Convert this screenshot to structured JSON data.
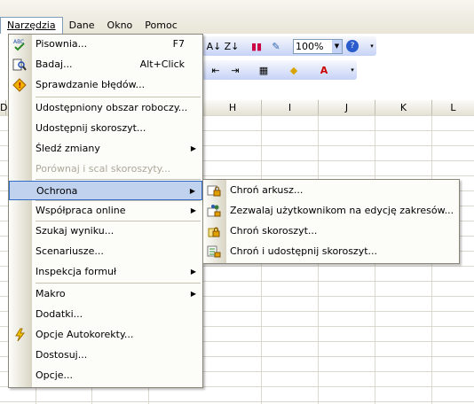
{
  "menubar": {
    "items": [
      "Narzędzia",
      "Dane",
      "Okno",
      "Pomoc"
    ]
  },
  "toolbar": {
    "zoom": "100%"
  },
  "columns": [
    "D",
    "H",
    "I",
    "J",
    "K",
    "L"
  ],
  "menu": {
    "items": [
      {
        "label": "Pisownia...",
        "shortcut": "F7",
        "icon": "spelling-icon"
      },
      {
        "label": "Badaj...",
        "shortcut": "Alt+Click",
        "icon": "research-icon"
      },
      {
        "label": "Sprawdzanie błędów...",
        "icon": "error-check-icon"
      },
      {
        "label": "Udostępniony obszar roboczy..."
      },
      {
        "label": "Udostępnij skoroszyt..."
      },
      {
        "label": "Śledź zmiany",
        "submenu": true
      },
      {
        "label": "Porównaj i scal skoroszyty...",
        "disabled": true
      },
      {
        "label": "Ochrona",
        "submenu": true,
        "highlight": true
      },
      {
        "label": "Współpraca online",
        "submenu": true
      },
      {
        "label": "Szukaj wyniku..."
      },
      {
        "label": "Scenariusze..."
      },
      {
        "label": "Inspekcja formuł",
        "submenu": true
      },
      {
        "label": "Makro",
        "submenu": true
      },
      {
        "label": "Dodatki..."
      },
      {
        "label": "Opcje Autokorekty...",
        "icon": "autocorrect-icon"
      },
      {
        "label": "Dostosuj..."
      },
      {
        "label": "Opcje..."
      }
    ]
  },
  "submenu": {
    "items": [
      {
        "label": "Chroń arkusz...",
        "icon": "protect-sheet-icon"
      },
      {
        "label": "Zezwalaj użytkownikom na edycję zakresów...",
        "icon": "allow-edit-ranges-icon"
      },
      {
        "label": "Chroń skoroszyt...",
        "icon": "protect-workbook-icon"
      },
      {
        "label": "Chroń i udostępnij skoroszyt...",
        "icon": "protect-share-icon"
      }
    ]
  }
}
